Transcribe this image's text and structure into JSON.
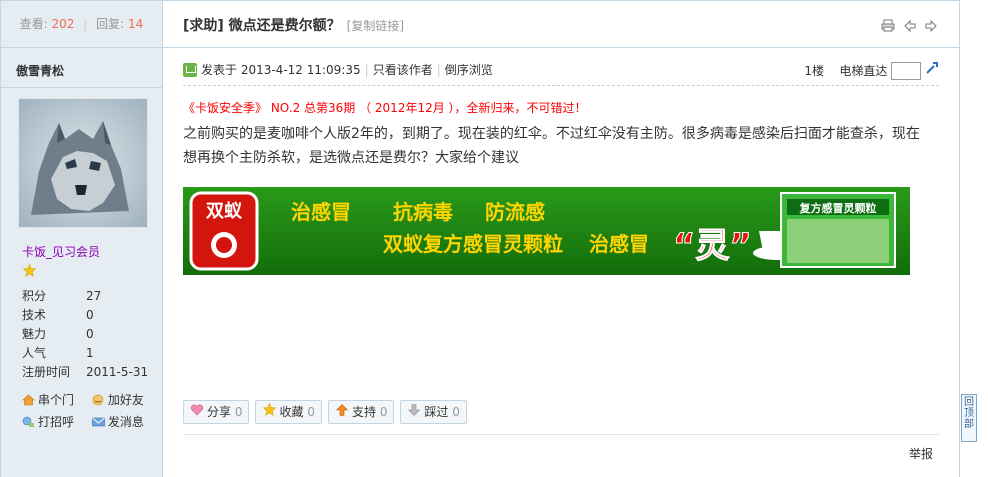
{
  "stats": {
    "views_label": "查看:",
    "views": "202",
    "replies_label": "回复:",
    "replies": "14"
  },
  "thread": {
    "title": "[求助] 微点还是费尔额？",
    "copy_link": "[复制链接]"
  },
  "user": {
    "name": "傲雪青松",
    "group": "卡饭_见习会员",
    "attrs": [
      {
        "k": "积分",
        "v": "27"
      },
      {
        "k": "技术",
        "v": "0"
      },
      {
        "k": "魅力",
        "v": "0"
      },
      {
        "k": "人气",
        "v": "1"
      },
      {
        "k": "注册时间",
        "v": "2011-5-31"
      }
    ],
    "links": {
      "visit": "串个门",
      "add_friend": "加好友",
      "poke": "打招呼",
      "message": "发消息"
    }
  },
  "post": {
    "posted_on": "发表于 2013-4-12 11:09:35",
    "only_author": "只看该作者",
    "reverse": "倒序浏览",
    "floor": "1楼",
    "elevator": "电梯直达",
    "promo": "《卡饭安全季》 NO.2 总第36期 （ 2012年12月 ），全新归来，不可错过！",
    "content": "之前购买的是麦咖啡个人版2年的，到期了。现在装的红伞。不过红伞没有主防。很多病毒是感染后扫面才能查杀，现在想再换个主防杀软，是选微点还是费尔？大家给个建议"
  },
  "banner": {
    "brand": "双蚁",
    "line1a": "治感冒",
    "line1b": "抗病毒",
    "line1c": "防流感",
    "line2": "双蚁复方感冒灵颗粒",
    "line2b": "治感冒",
    "ling": "“灵”",
    "box_text": "复方感冒灵颗粒"
  },
  "actions": [
    {
      "label": "分享",
      "count": "0",
      "icon": "heart-icon"
    },
    {
      "label": "收藏",
      "count": "0",
      "icon": "star-icon"
    },
    {
      "label": "支持",
      "count": "0",
      "icon": "arrow-up-icon"
    },
    {
      "label": "踩过",
      "count": "0",
      "icon": "arrow-down-icon"
    }
  ],
  "report": "举报",
  "back_to_top": "回顶部",
  "colors": {
    "accent": "#f26c4f",
    "sidebar_bg": "#e5edf2",
    "border": "#c2d5e3",
    "banner_green": "#1e8a12",
    "promo_red": "#ff0000"
  }
}
